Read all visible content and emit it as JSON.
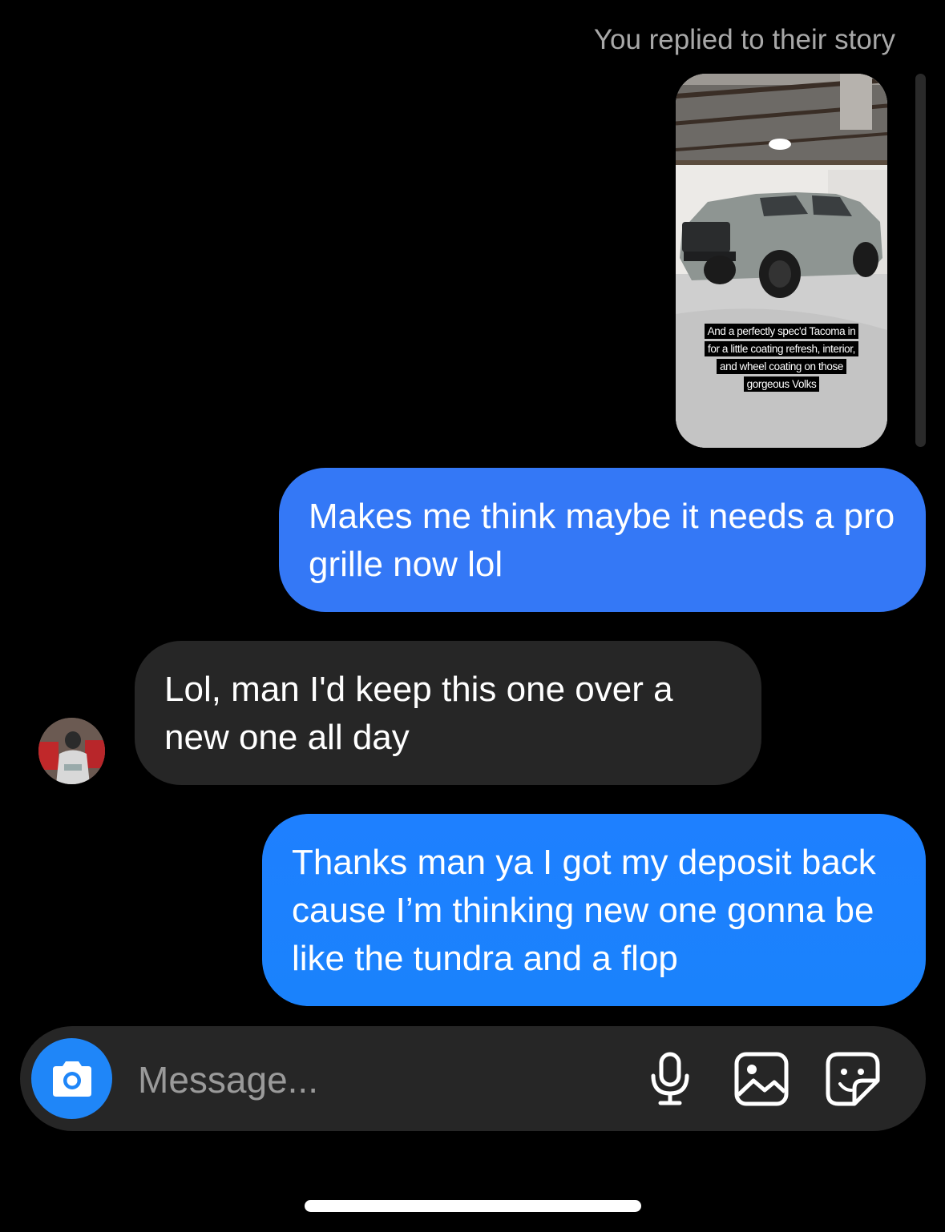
{
  "thread": {
    "story_reply_note": "You replied to their story",
    "story": {
      "caption_lines": [
        "And a perfectly spec'd Tacoma in",
        "for a little coating refresh, interior,",
        "and wheel coating on those",
        "gorgeous Volks"
      ]
    },
    "messages": [
      {
        "sender": "me",
        "text": "Makes me think maybe it needs a pro grille now lol"
      },
      {
        "sender": "them",
        "text": "Lol, man I'd keep this one over a new one all day"
      },
      {
        "sender": "me",
        "text": "Thanks man ya I got my deposit back cause I’m thinking new one gonna be like the tundra and a flop"
      }
    ]
  },
  "composer": {
    "placeholder": "Message...",
    "icons": {
      "camera": "camera-icon",
      "mic": "microphone-icon",
      "gallery": "gallery-icon",
      "sticker": "sticker-icon"
    }
  },
  "colors": {
    "background": "#000000",
    "sent_bubble": "#3478f6",
    "received_bubble": "#262626",
    "composer_bg": "#262626",
    "camera_button": "#1f86f8",
    "muted_text": "#a8a8a8"
  }
}
